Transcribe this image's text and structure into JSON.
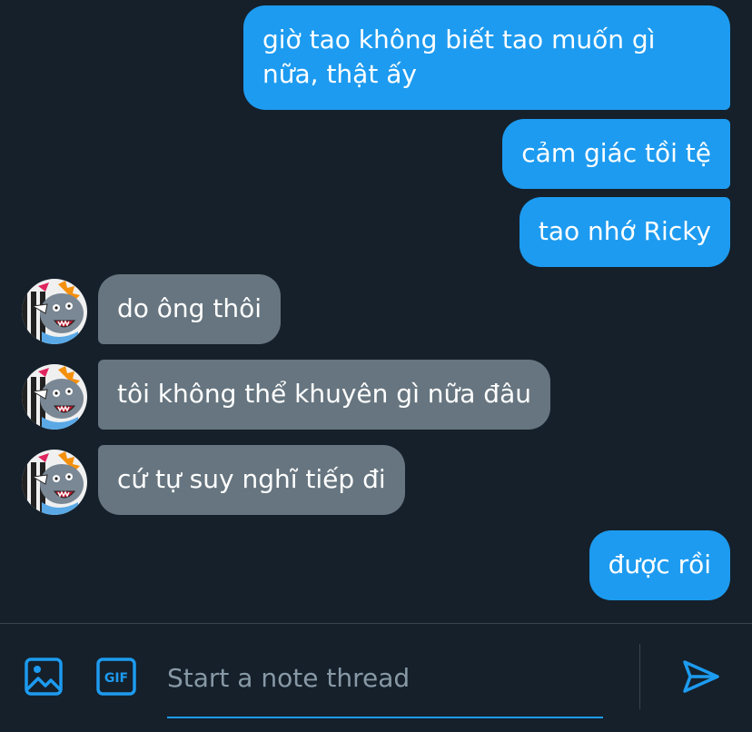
{
  "conversation": {
    "messages": [
      {
        "from": "me",
        "text": "giờ tao không biết tao muốn gì nữa, thật ấy"
      },
      {
        "from": "me",
        "text": "cảm giác tồi tệ"
      },
      {
        "from": "me",
        "text": "tao nhớ Ricky"
      },
      {
        "from": "them",
        "text": "do ông thôi"
      },
      {
        "from": "them",
        "text": "tôi không thể khuyên gì nữa đâu"
      },
      {
        "from": "them",
        "text": "cứ tự suy nghĩ tiếp đi"
      },
      {
        "from": "me",
        "text": "được rồi"
      }
    ]
  },
  "composer": {
    "placeholder": "Start a note thread",
    "media_icon": "image-icon",
    "gif_icon": "gif-icon",
    "gif_label": "GIF",
    "send_icon": "send-icon"
  },
  "colors": {
    "background": "#15202b",
    "outgoing_bubble": "#1d9bf0",
    "incoming_bubble": "#66757f",
    "accent": "#1d9bf0",
    "placeholder": "#8899a6",
    "border": "#38444d"
  }
}
